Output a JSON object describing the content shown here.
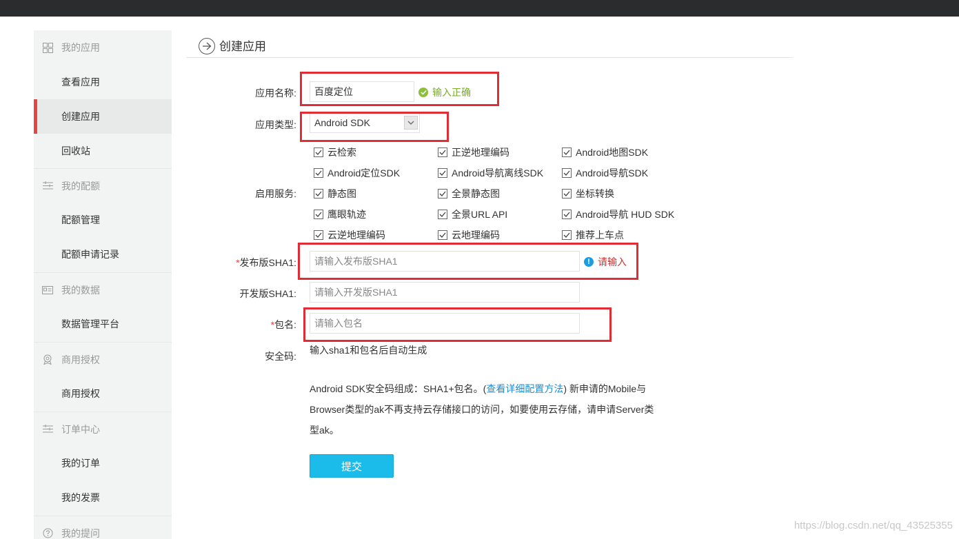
{
  "page": {
    "title": "创建应用"
  },
  "sidebar": {
    "groups": [
      {
        "label": "我的应用",
        "icon": "grid-icon"
      },
      {
        "label": "我的配额",
        "icon": "list-icon"
      },
      {
        "label": "我的数据",
        "icon": "id-card-icon"
      },
      {
        "label": "商用授权",
        "icon": "badge-icon"
      },
      {
        "label": "订单中心",
        "icon": "list-icon"
      },
      {
        "label": "我的提问",
        "icon": "question-icon"
      }
    ],
    "items": [
      {
        "label": "查看应用"
      },
      {
        "label": "创建应用",
        "active": true
      },
      {
        "label": "回收站"
      },
      {
        "label": "配额管理"
      },
      {
        "label": "配额申请记录"
      },
      {
        "label": "数据管理平台"
      },
      {
        "label": "商用授权"
      },
      {
        "label": "我的订单"
      },
      {
        "label": "我的发票"
      }
    ]
  },
  "form": {
    "app_name": {
      "label": "应用名称:",
      "value": "百度定位",
      "status": "输入正确"
    },
    "app_type": {
      "label": "应用类型:",
      "value": "Android SDK"
    },
    "services": {
      "label": "启用服务:",
      "options": [
        {
          "label": "云检索",
          "checked": true
        },
        {
          "label": "正逆地理编码",
          "checked": true
        },
        {
          "label": "Android地图SDK",
          "checked": true
        },
        {
          "label": "Android定位SDK",
          "checked": true
        },
        {
          "label": "Android导航离线SDK",
          "checked": true
        },
        {
          "label": "Android导航SDK",
          "checked": true
        },
        {
          "label": "静态图",
          "checked": true
        },
        {
          "label": "全景静态图",
          "checked": true
        },
        {
          "label": "坐标转换",
          "checked": true
        },
        {
          "label": "鹰眼轨迹",
          "checked": true
        },
        {
          "label": "全景URL API",
          "checked": true
        },
        {
          "label": "Android导航 HUD SDK",
          "checked": true
        },
        {
          "label": "云逆地理编码",
          "checked": true
        },
        {
          "label": "云地理编码",
          "checked": true
        },
        {
          "label": "推荐上车点",
          "checked": true
        }
      ]
    },
    "release_sha1": {
      "required_mark": "*",
      "label": "发布版SHA1:",
      "placeholder": "请输入发布版SHA1",
      "error": "请输入"
    },
    "dev_sha1": {
      "label": "开发版SHA1:",
      "placeholder": "请输入开发版SHA1"
    },
    "package": {
      "required_mark": "*",
      "label": "包名:",
      "placeholder": "请输入包名"
    },
    "security_code": {
      "label": "安全码:",
      "value": "输入sha1和包名后自动生成"
    },
    "note": {
      "before_link": "Android SDK安全码组成：SHA1+包名。(",
      "link": "查看详细配置方法",
      "after_link": ") 新申请的Mobile与Browser类型的ak不再支持云存储接口的访问，如要使用云存储，请申请Server类型ak。"
    },
    "submit_label": "提交"
  },
  "watermark": "https://blog.csdn.net/qq_43525355",
  "colors": {
    "accent_red": "#e64541",
    "submit_blue": "#1cbcea",
    "ok_green": "#7aaf2a",
    "link_blue": "#1a8fd8"
  }
}
